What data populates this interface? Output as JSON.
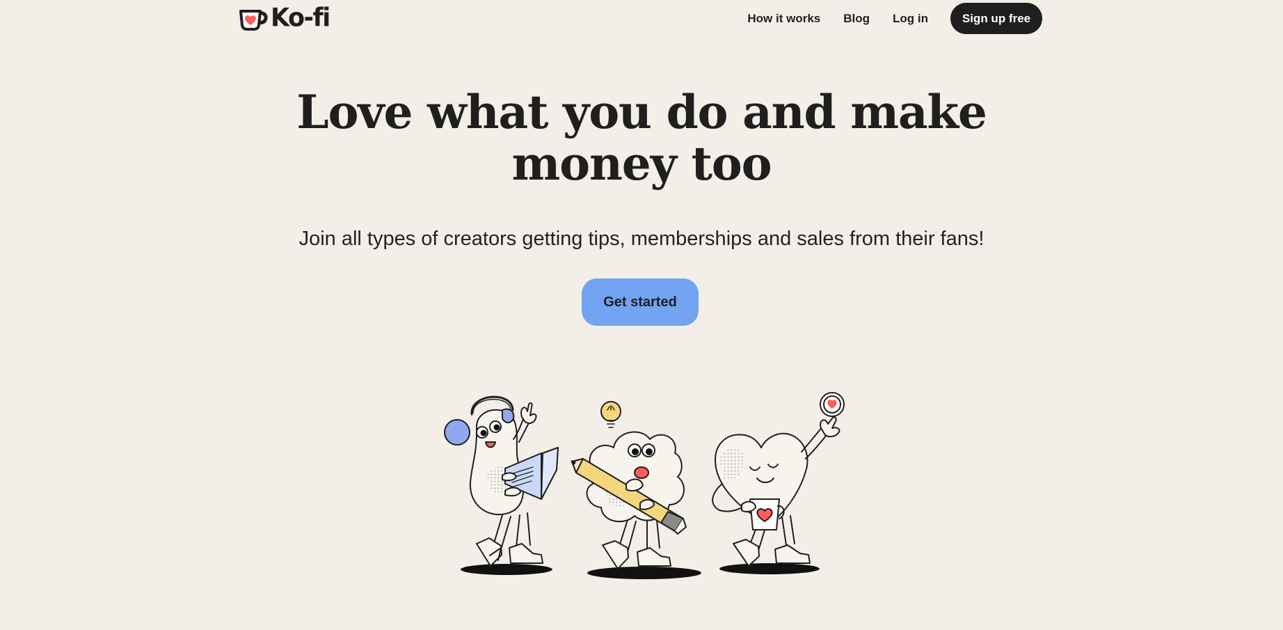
{
  "header": {
    "logo_text": "Ko-fi",
    "logo_icon": "ko-fi-mug-heart-icon",
    "nav": {
      "how_it_works": "How it works",
      "blog": "Blog",
      "log_in": "Log in",
      "sign_up": "Sign up free"
    }
  },
  "hero": {
    "title_line1": "Love what you do and make",
    "title_line2": "money too",
    "subtitle": "Join all types of creators getting tips, memberships and sales from their fans!",
    "cta": "Get started"
  },
  "illustration": {
    "characters": [
      "creator-with-laptop",
      "creator-with-pencil",
      "heart-creator-with-mug"
    ]
  },
  "colors": {
    "background": "#f3efe8",
    "ink": "#1f1f1f",
    "accent_blue": "#72a4f2",
    "brand_red": "#ff5e5b",
    "pencil_yellow": "#f4d77c",
    "laptop_blue": "#c9d9f7"
  }
}
